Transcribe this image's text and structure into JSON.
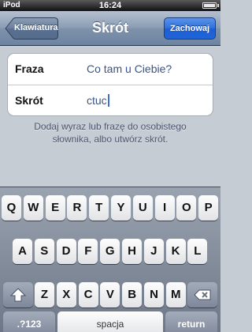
{
  "status_bar": {
    "carrier": "iPod",
    "time": "16:24",
    "battery_level": 0.86
  },
  "nav_bar": {
    "back_label": "Klawiatura",
    "title": "Skrót",
    "save_label": "Zachowaj"
  },
  "form": {
    "phrase_label": "Fraza",
    "phrase_value": "Co tam u Ciebie?",
    "shortcut_label": "Skrót",
    "shortcut_value": "ctuc"
  },
  "footer_text": "Dodaj wyraz lub frazę do osobistego słownika, albo utwórz skrót.",
  "keyboard": {
    "row1": [
      "Q",
      "W",
      "E",
      "R",
      "T",
      "Y",
      "U",
      "I",
      "O",
      "P"
    ],
    "row2": [
      "A",
      "S",
      "D",
      "F",
      "G",
      "H",
      "J",
      "K",
      "L"
    ],
    "row3": [
      "Z",
      "X",
      "C",
      "V",
      "B",
      "N",
      "M"
    ],
    "numbers_label": ".?123",
    "space_label": "spacja",
    "return_label": "return",
    "shift_icon": "shift-icon",
    "delete_icon": "delete-icon"
  },
  "colors": {
    "nav_tint": "#6d84a2",
    "save_button": "#2f6fdc",
    "value_text": "#385487"
  }
}
